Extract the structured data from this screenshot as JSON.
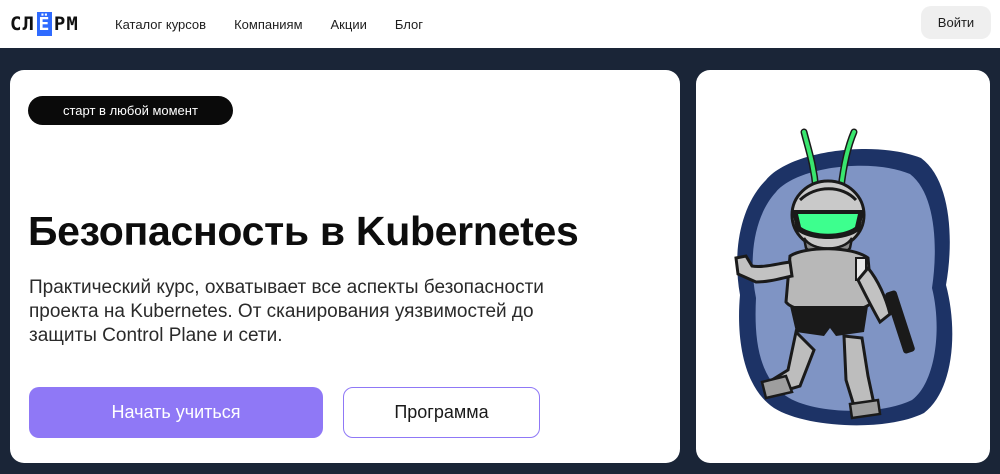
{
  "header": {
    "logo": {
      "part1": "СЛ",
      "part2": "Ё",
      "part3": "РМ"
    },
    "nav": [
      "Каталог курсов",
      "Компаниям",
      "Акции",
      "Блог"
    ],
    "login_label": "Войти"
  },
  "hero": {
    "badge": "старт в любой момент",
    "title": "Безопасность в Kubernetes",
    "description": "Практический курс, охватывает все аспекты безопасности проекта на Kubernetes. От сканирования уязвимостей до защиты Control Plane и сети.",
    "primary_button": "Начать учиться",
    "secondary_button": "Программа"
  },
  "colors": {
    "accent": "#8f78f6",
    "page_background": "#1a2537",
    "logo_box": "#2f6bff",
    "visor": "#3dff8e"
  },
  "illustration": {
    "icon": "robot-mascot-icon"
  }
}
